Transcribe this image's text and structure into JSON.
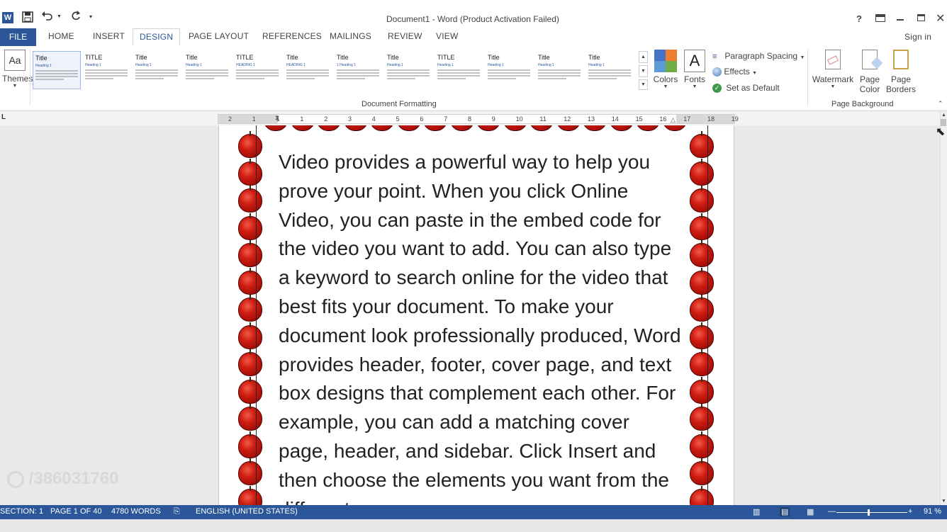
{
  "window": {
    "title": "Document1 - Word (Product Activation Failed)",
    "help": "?",
    "sign_in": "Sign in"
  },
  "quick_access": {
    "app_icon": "W",
    "save_icon": "save-icon",
    "undo_icon": "undo-icon",
    "redo_icon": "redo-icon",
    "customize_icon": "customize-qat-icon"
  },
  "tabs": {
    "file": "FILE",
    "home": "HOME",
    "insert": "INSERT",
    "design": "DESIGN",
    "page_layout": "PAGE LAYOUT",
    "references": "REFERENCES",
    "mailings": "MAILINGS",
    "review": "REVIEW",
    "view": "VIEW"
  },
  "ribbon": {
    "themes_label": "Themes",
    "themes_glyph": "Aa",
    "style_sets": [
      {
        "title": "Title",
        "heading": "Heading 1"
      },
      {
        "title": "TITLE",
        "heading": "Heading 1"
      },
      {
        "title": "Title",
        "heading": "Heading 1"
      },
      {
        "title": "Title",
        "heading": "Heading 1"
      },
      {
        "title": "TITLE",
        "heading": "HEADING 1"
      },
      {
        "title": "Title",
        "heading": "HEADING 1"
      },
      {
        "title": "Title",
        "heading": "1 Heading 1"
      },
      {
        "title": "Title",
        "heading": "Heading 1"
      },
      {
        "title": "TITLE",
        "heading": "Heading 1"
      },
      {
        "title": "Title",
        "heading": "Heading 1"
      },
      {
        "title": "Title",
        "heading": "Heading 1"
      },
      {
        "title": "Title",
        "heading": "Heading 1"
      }
    ],
    "group_document_formatting": "Document Formatting",
    "colors_label": "Colors",
    "fonts_label": "Fonts",
    "fonts_glyph": "A",
    "paragraph_spacing_label": "Paragraph Spacing",
    "effects_label": "Effects",
    "set_as_default_label": "Set as Default",
    "watermark_label": "Watermark",
    "page_color_label": "Page Color",
    "page_borders_label": "Page Borders",
    "group_page_background": "Page Background"
  },
  "ruler": {
    "ticks": [
      "2",
      "1",
      "1",
      "1",
      "2",
      "3",
      "4",
      "5",
      "6",
      "7",
      "8",
      "9",
      "10",
      "11",
      "12",
      "13",
      "14",
      "15",
      "16",
      "17",
      "18",
      "19"
    ],
    "tab_selector": "L"
  },
  "document": {
    "body_text": "Video provides a powerful way to help you prove your point. When you click Online Video, you can paste in the embed code for the video you want to add. You can also type a keyword to search online for the video that best fits your document. To make your document look professionally produced, Word provides header, footer, cover page, and text box designs that complement each other. For example, you can add a matching cover page, header, and sidebar. Click Insert and then choose the elements you want from the different"
  },
  "watermark_overlay": "/386031760",
  "statusbar": {
    "section": "SECTION: 1",
    "page": "PAGE 1 OF 40",
    "words": "4780 WORDS",
    "language": "ENGLISH (UNITED STATES)",
    "zoom": "91 %"
  },
  "colors": {
    "accent": "#2b579a",
    "apple_red": "#d01e12"
  }
}
